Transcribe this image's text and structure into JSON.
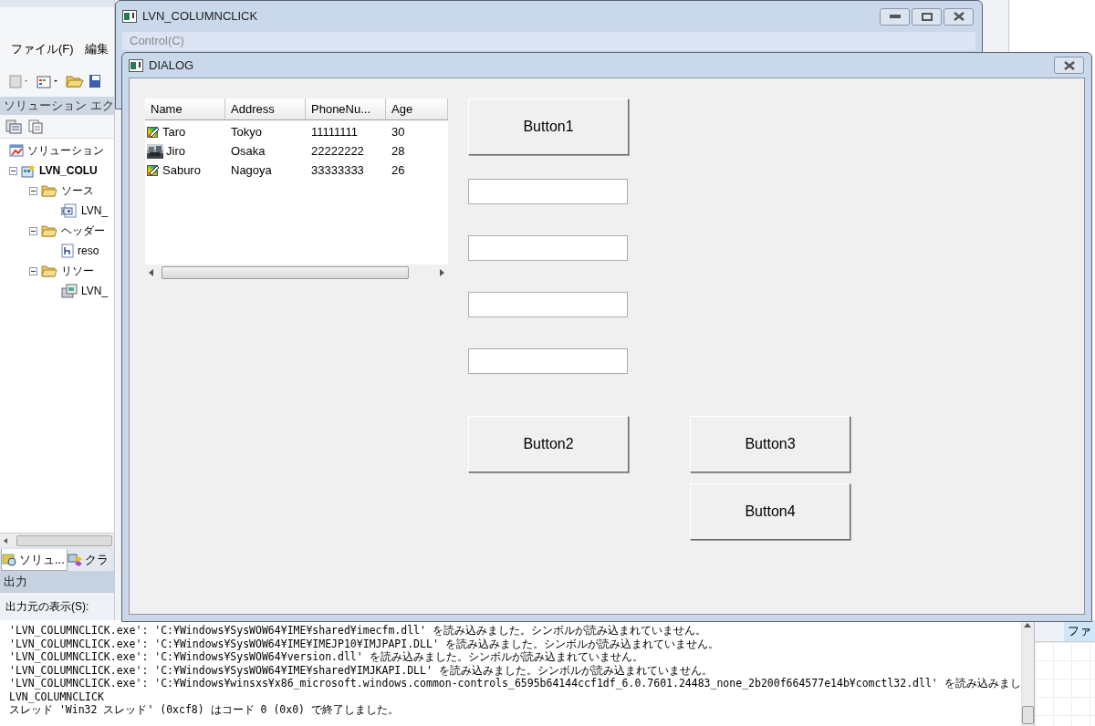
{
  "ide": {
    "menu": [
      "ファイル(F)",
      "編集"
    ],
    "solution_explorer": {
      "title": "ソリューション エク",
      "tree": [
        {
          "label": "ソリューション",
          "kind": "solution",
          "bold": false
        },
        {
          "label": "LVN_COLU",
          "kind": "project",
          "bold": true,
          "expanded": true,
          "children": [
            {
              "label": "ソース",
              "kind": "folder",
              "bold": false,
              "expanded": true,
              "children": [
                {
                  "label": "LVN_",
                  "kind": "cpp",
                  "bold": false
                }
              ]
            },
            {
              "label": "ヘッダー",
              "kind": "folder",
              "bold": false,
              "expanded": true,
              "children": [
                {
                  "label": "reso",
                  "kind": "header",
                  "bold": false
                }
              ]
            },
            {
              "label": "リソー",
              "kind": "folder",
              "bold": false,
              "expanded": true,
              "children": [
                {
                  "label": "LVN_",
                  "kind": "resource",
                  "bold": false
                }
              ]
            }
          ]
        }
      ]
    },
    "panel_tabs": [
      {
        "label": "ソリュ...",
        "selected": true
      },
      {
        "label": "クラ",
        "selected": false
      }
    ],
    "output": {
      "title": "出力",
      "source_label": "出力元の表示(S):",
      "lines": [
        "'LVN_COLUMNCLICK.exe': 'C:¥Windows¥SysWOW64¥IME¥shared¥imecfm.dll' を読み込みました。シンボルが読み込まれていません。",
        "'LVN_COLUMNCLICK.exe': 'C:¥Windows¥SysWOW64¥IME¥IMEJP10¥IMJPAPI.DLL' を読み込みました。シンボルが読み込まれていません。",
        "'LVN_COLUMNCLICK.exe': 'C:¥Windows¥SysWOW64¥version.dll' を読み込みました。シンボルが読み込まれていません。",
        "'LVN_COLUMNCLICK.exe': 'C:¥Windows¥SysWOW64¥IME¥shared¥IMJKAPI.DLL' を読み込みました。シンボルが読み込まれていません。",
        "'LVN_COLUMNCLICK.exe': 'C:¥Windows¥winsxs¥x86_microsoft.windows.common-controls_6595b64144ccf1df_6.0.7601.24483_none_2b200f664577e14b¥comctl32.dll' を読み込みまし",
        "LVN_COLUMNCLICK",
        "スレッド 'Win32 スレッド' (0xcf8) はコード 0 (0x0) で終了しました。"
      ]
    },
    "right_pane": {
      "tab": "ファ"
    }
  },
  "main_window": {
    "title": "LVN_COLUMNCLICK",
    "menu": [
      {
        "label": "Control(C)",
        "disabled": true
      }
    ]
  },
  "dialog": {
    "title": "DIALOG",
    "list": {
      "columns": [
        "Name",
        "Address",
        "PhoneNu...",
        "Age"
      ],
      "rows": [
        {
          "kind": "pencil",
          "cells": [
            "Taro",
            "Tokyo",
            "11111111",
            "30"
          ]
        },
        {
          "kind": "picture",
          "cells": [
            "Jiro",
            "Osaka",
            "22222222",
            "28"
          ]
        },
        {
          "kind": "pencil",
          "cells": [
            "Saburo",
            "Nagoya",
            "33333333",
            "26"
          ]
        }
      ]
    },
    "buttons": [
      "Button1",
      "Button2",
      "Button3",
      "Button4"
    ]
  }
}
